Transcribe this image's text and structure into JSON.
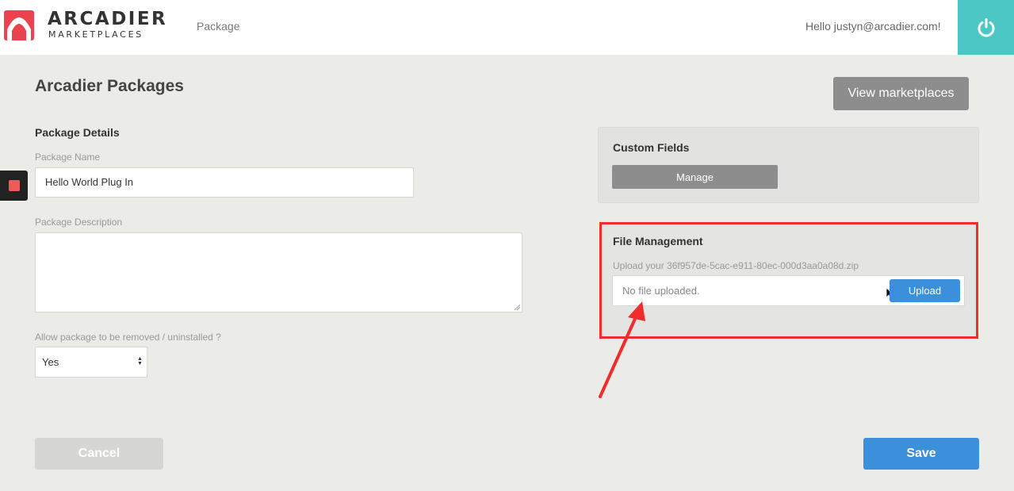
{
  "header": {
    "logo_title": "ARCADIER",
    "logo_subtitle": "MARKETPLACES",
    "nav_item": "Package",
    "greeting": "Hello justyn@arcadier.com!"
  },
  "page": {
    "title": "Arcadier Packages",
    "view_marketplaces_label": "View marketplaces"
  },
  "package_details": {
    "section_title": "Package Details",
    "name_label": "Package Name",
    "name_value": "Hello World Plug In",
    "description_label": "Package Description",
    "description_value": "",
    "removable_label": "Allow package to be removed / uninstalled ?",
    "removable_value": "Yes"
  },
  "custom_fields": {
    "title": "Custom Fields",
    "manage_label": "Manage"
  },
  "file_management": {
    "title": "File Management",
    "hint": "Upload your 36f957de-5cac-e911-80ec-000d3aa0a08d.zip",
    "status": "No file uploaded.",
    "upload_label": "Upload"
  },
  "footer": {
    "cancel_label": "Cancel",
    "save_label": "Save"
  },
  "colors": {
    "brand_red": "#e8434e",
    "power_teal": "#4dc6c6",
    "primary_blue": "#3b8fdb",
    "annotation_red": "#f22c2c"
  }
}
